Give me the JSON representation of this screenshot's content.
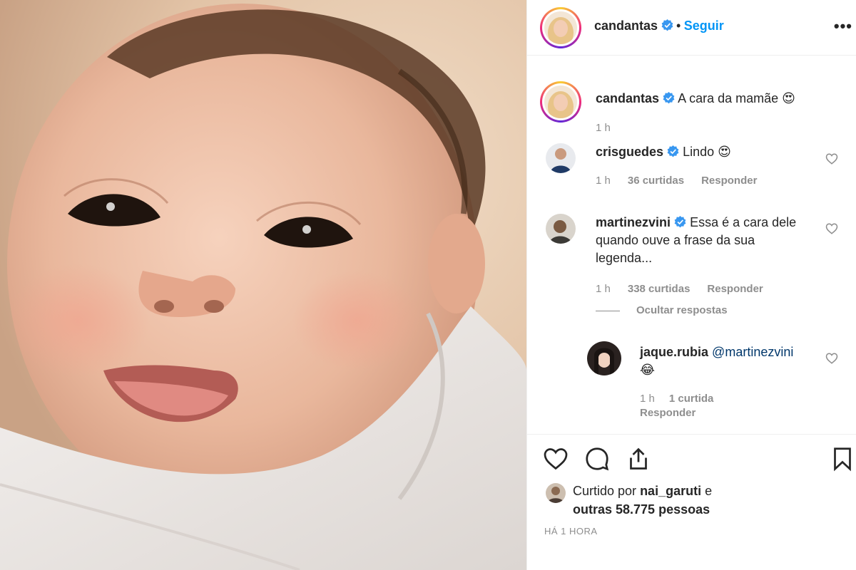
{
  "header": {
    "username": "candantas",
    "separator": "•",
    "follow_label": "Seguir",
    "more_label": "•••"
  },
  "caption": {
    "username": "candantas",
    "text": "A cara da mamãe 😍",
    "time": "1 h"
  },
  "comments": [
    {
      "username": "crisguedes",
      "text": "Lindo 😍",
      "time": "1 h",
      "likes": "36 curtidas",
      "reply_label": "Responder"
    },
    {
      "username": "martinezvini",
      "text_line1": "Essa é a cara dele",
      "text_line2": "quando ouve a frase da sua",
      "text_line3": "legenda...",
      "time": "1 h",
      "likes": "338 curtidas",
      "reply_label": "Responder",
      "hide_replies_label": "Ocultar respostas"
    }
  ],
  "reply": {
    "username": "jaque.rubia",
    "mention": "@martinezvini",
    "text": "😂",
    "time": "1 h",
    "likes": "1 curtida",
    "reply_label": "Responder"
  },
  "liked_by": {
    "prefix": "Curtido por",
    "user": "nai_garuti",
    "and": "e",
    "others": "outras 58.775 pessoas"
  },
  "timestamp": "HÁ 1 HORA",
  "icons": [
    "verified-icon",
    "heart-icon",
    "comment-icon",
    "share-icon",
    "bookmark-icon",
    "more-icon"
  ],
  "colors": {
    "link_blue": "#0095f6",
    "verified_blue": "#3897f0",
    "muted": "#8e8e8e",
    "text": "#262626"
  }
}
